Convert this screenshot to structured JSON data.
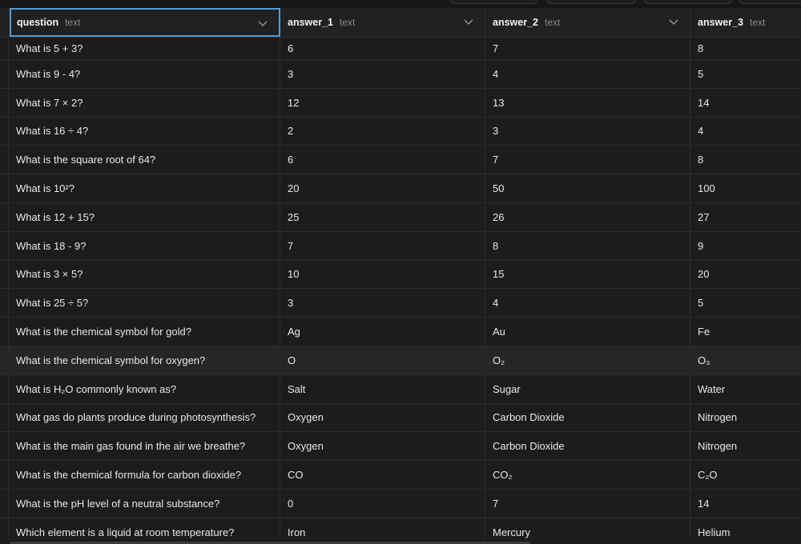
{
  "columns": [
    {
      "name": "question",
      "type": "text"
    },
    {
      "name": "answer_1",
      "type": "text"
    },
    {
      "name": "answer_2",
      "type": "text"
    },
    {
      "name": "answer_3",
      "type": "text"
    }
  ],
  "rows": [
    [
      "What is 5 + 3?",
      "6",
      "7",
      "8"
    ],
    [
      "What is 9 - 4?",
      "3",
      "4",
      "5"
    ],
    [
      "What is 7 × 2?",
      "12",
      "13",
      "14"
    ],
    [
      "What is 16 ÷ 4?",
      "2",
      "3",
      "4"
    ],
    [
      "What is the square root of 64?",
      "6",
      "7",
      "8"
    ],
    [
      "What is 10²?",
      "20",
      "50",
      "100"
    ],
    [
      "What is 12 + 15?",
      "25",
      "26",
      "27"
    ],
    [
      "What is 18 - 9?",
      "7",
      "8",
      "9"
    ],
    [
      "What is 3 × 5?",
      "10",
      "15",
      "20"
    ],
    [
      "What is 25 ÷ 5?",
      "3",
      "4",
      "5"
    ],
    [
      "What is the chemical symbol for gold?",
      "Ag",
      "Au",
      "Fe"
    ],
    [
      "What is the chemical symbol for oxygen?",
      "O",
      "O₂",
      "O₃"
    ],
    [
      "What is H₂O commonly known as?",
      "Salt",
      "Sugar",
      "Water"
    ],
    [
      "What gas do plants produce during photosynthesis?",
      "Oxygen",
      "Carbon Dioxide",
      "Nitrogen"
    ],
    [
      "What is the main gas found in the air we breathe?",
      "Oxygen",
      "Carbon Dioxide",
      "Nitrogen"
    ],
    [
      "What is the chemical formula for carbon dioxide?",
      "CO",
      "CO₂",
      "C₂O"
    ],
    [
      "What is the pH level of a neutral substance?",
      "0",
      "7",
      "14"
    ],
    [
      "Which element is a liquid at room temperature?",
      "Iron",
      "Mercury",
      "Helium"
    ]
  ],
  "selected_column": 0,
  "highlighted_row": 11,
  "colors": {
    "background": "#1c1c1c",
    "header": "#212121",
    "selection_border": "#4f9cd9",
    "row_hover": "#262626"
  },
  "icons": {
    "column_menu": "chevron-down-icon"
  }
}
